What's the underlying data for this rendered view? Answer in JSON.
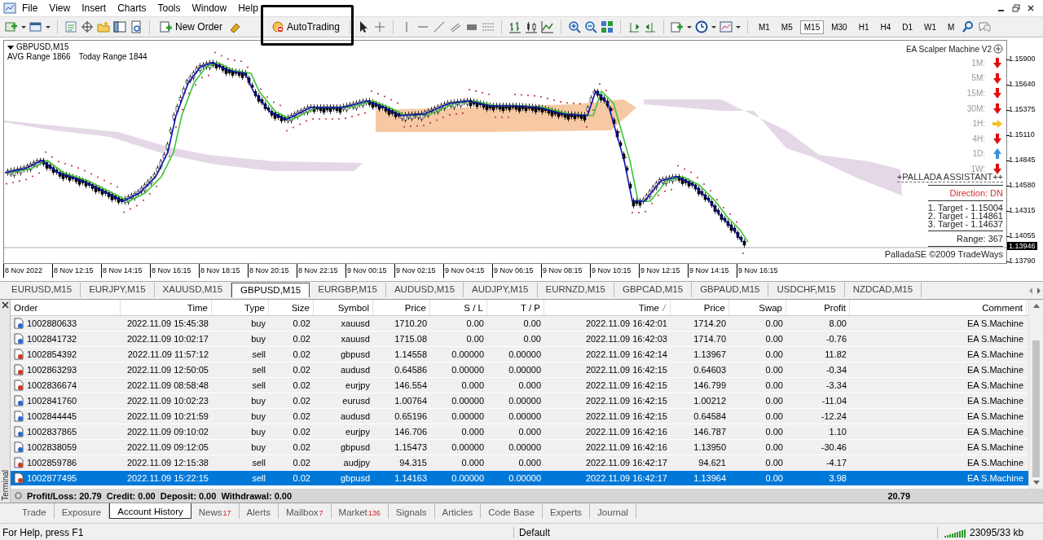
{
  "menu": [
    "File",
    "View",
    "Insert",
    "Charts",
    "Tools",
    "Window",
    "Help"
  ],
  "toolbar": {
    "new_order": "New Order",
    "autotrading": "AutoTrading",
    "timeframes": [
      {
        "label": "M1",
        "selected": false
      },
      {
        "label": "M5",
        "selected": false
      },
      {
        "label": "M15",
        "selected": true
      },
      {
        "label": "M30",
        "selected": false
      },
      {
        "label": "H1",
        "selected": false
      },
      {
        "label": "H4",
        "selected": false
      },
      {
        "label": "D1",
        "selected": false
      },
      {
        "label": "W1",
        "selected": false
      },
      {
        "label": "M",
        "selected": false
      }
    ]
  },
  "chart": {
    "title": "GBPUSD,M15",
    "avg_range": "AVG Range 1866",
    "today_range": "Today Range 1844",
    "price_ticks": [
      "1.15900",
      "1.15640",
      "1.15375",
      "1.15110",
      "1.14845",
      "1.14580",
      "1.14315",
      "1.14055",
      "1.13790"
    ],
    "current_price": "1.13946",
    "time_labels": [
      "8 Nov 2022",
      "8 Nov 12:15",
      "8 Nov 14:15",
      "8 Nov 16:15",
      "8 Nov 18:15",
      "8 Nov 20:15",
      "8 Nov 22:15",
      "9 Nov 00:15",
      "9 Nov 02:15",
      "9 Nov 04:15",
      "9 Nov 06:15",
      "9 Nov 08:15",
      "9 Nov 10:15",
      "9 Nov 12:15",
      "9 Nov 14:15",
      "9 Nov 16:15"
    ],
    "indicator": {
      "title": "EA Scalper Machine V2",
      "signals": [
        {
          "label": "1M:",
          "kind": "down"
        },
        {
          "label": "5M:",
          "kind": "down"
        },
        {
          "label": "15M:",
          "kind": "down"
        },
        {
          "label": "30M:",
          "kind": "down"
        },
        {
          "label": "1H:",
          "kind": "right"
        },
        {
          "label": "4H:",
          "kind": "down"
        },
        {
          "label": "1D:",
          "kind": "up"
        },
        {
          "label": "1W:",
          "kind": "down"
        }
      ],
      "assistant": "+PALLADA ASSISTANT++",
      "direction": "Direction: DN",
      "targets": [
        "1. Target - 1.15004",
        "2. Target - 1.14861",
        "3. Target - 1.14637"
      ],
      "range": "Range: 367",
      "credit": "PalladaSE ©2009 TradeWays"
    }
  },
  "symbol_tabs": [
    {
      "label": "EURUSD,M15",
      "selected": false
    },
    {
      "label": "EURJPY,M15",
      "selected": false
    },
    {
      "label": "XAUUSD,M15",
      "selected": false
    },
    {
      "label": "GBPUSD,M15",
      "selected": true
    },
    {
      "label": "EURGBP,M15",
      "selected": false
    },
    {
      "label": "AUDUSD,M15",
      "selected": false
    },
    {
      "label": "AUDJPY,M15",
      "selected": false
    },
    {
      "label": "EURNZD,M15",
      "selected": false
    },
    {
      "label": "GBPCAD,M15",
      "selected": false
    },
    {
      "label": "GBPAUD,M15",
      "selected": false
    },
    {
      "label": "USDCHF,M15",
      "selected": false
    },
    {
      "label": "NZDCAD,M15",
      "selected": false
    }
  ],
  "table": {
    "columns": [
      {
        "label": "Order",
        "sorted": false
      },
      {
        "label": "Time",
        "sorted": false
      },
      {
        "label": "Type",
        "sorted": false
      },
      {
        "label": "Size",
        "sorted": false
      },
      {
        "label": "Symbol",
        "sorted": false
      },
      {
        "label": "Price",
        "sorted": false
      },
      {
        "label": "S / L",
        "sorted": false
      },
      {
        "label": "T / P",
        "sorted": false
      },
      {
        "label": "Time",
        "sorted": true
      },
      {
        "label": "Price",
        "sorted": false
      },
      {
        "label": "Swap",
        "sorted": false
      },
      {
        "label": "Profit",
        "sorted": false
      },
      {
        "label": "Comment",
        "sorted": false
      }
    ],
    "rows": [
      {
        "kind": "buy",
        "selected": false,
        "cells": [
          "1002880633",
          "2022.11.09 15:45:38",
          "buy",
          "0.02",
          "xauusd",
          "1710.20",
          "0.00",
          "0.00",
          "2022.11.09 16:42:01",
          "1714.20",
          "0.00",
          "8.00",
          "EA S.Machine"
        ]
      },
      {
        "kind": "buy",
        "selected": false,
        "cells": [
          "1002841732",
          "2022.11.09 10:02:17",
          "buy",
          "0.02",
          "xauusd",
          "1715.08",
          "0.00",
          "0.00",
          "2022.11.09 16:42:03",
          "1714.70",
          "0.00",
          "-0.76",
          "EA S.Machine"
        ]
      },
      {
        "kind": "sell",
        "selected": false,
        "cells": [
          "1002854392",
          "2022.11.09 11:57:12",
          "sell",
          "0.02",
          "gbpusd",
          "1.14558",
          "0.00000",
          "0.00000",
          "2022.11.09 16:42:14",
          "1.13967",
          "0.00",
          "11.82",
          "EA S.Machine"
        ]
      },
      {
        "kind": "sell",
        "selected": false,
        "cells": [
          "1002863293",
          "2022.11.09 12:50:05",
          "sell",
          "0.02",
          "audusd",
          "0.64586",
          "0.00000",
          "0.00000",
          "2022.11.09 16:42:15",
          "0.64603",
          "0.00",
          "-0.34",
          "EA S.Machine"
        ]
      },
      {
        "kind": "sell",
        "selected": false,
        "cells": [
          "1002836674",
          "2022.11.09 08:58:48",
          "sell",
          "0.02",
          "eurjpy",
          "146.554",
          "0.000",
          "0.000",
          "2022.11.09 16:42:15",
          "146.799",
          "0.00",
          "-3.34",
          "EA S.Machine"
        ]
      },
      {
        "kind": "buy",
        "selected": false,
        "cells": [
          "1002841760",
          "2022.11.09 10:02:23",
          "buy",
          "0.02",
          "eurusd",
          "1.00764",
          "0.00000",
          "0.00000",
          "2022.11.09 16:42:15",
          "1.00212",
          "0.00",
          "-11.04",
          "EA S.Machine"
        ]
      },
      {
        "kind": "buy",
        "selected": false,
        "cells": [
          "1002844445",
          "2022.11.09 10:21:59",
          "buy",
          "0.02",
          "audusd",
          "0.65196",
          "0.00000",
          "0.00000",
          "2022.11.09 16:42:15",
          "0.64584",
          "0.00",
          "-12.24",
          "EA S.Machine"
        ]
      },
      {
        "kind": "buy",
        "selected": false,
        "cells": [
          "1002837865",
          "2022.11.09 09:10:02",
          "buy",
          "0.02",
          "eurjpy",
          "146.706",
          "0.000",
          "0.000",
          "2022.11.09 16:42:16",
          "146.787",
          "0.00",
          "1.10",
          "EA S.Machine"
        ]
      },
      {
        "kind": "buy",
        "selected": false,
        "cells": [
          "1002838059",
          "2022.11.09 09:12:05",
          "buy",
          "0.02",
          "gbpusd",
          "1.15473",
          "0.00000",
          "0.00000",
          "2022.11.09 16:42:16",
          "1.13950",
          "0.00",
          "-30.46",
          "EA S.Machine"
        ]
      },
      {
        "kind": "sell",
        "selected": false,
        "cells": [
          "1002859786",
          "2022.11.09 12:15:38",
          "sell",
          "0.02",
          "audjpy",
          "94.315",
          "0.000",
          "0.000",
          "2022.11.09 16:42:17",
          "94.621",
          "0.00",
          "-4.17",
          "EA S.Machine"
        ]
      },
      {
        "kind": "sell",
        "selected": true,
        "cells": [
          "1002877495",
          "2022.11.09 15:22:15",
          "sell",
          "0.02",
          "gbpusd",
          "1.14163",
          "0.00000",
          "0.00000",
          "2022.11.09 16:42:17",
          "1.13964",
          "0.00",
          "3.98",
          "EA S.Machine"
        ]
      }
    ],
    "summary": "Profit/Loss: 20.79  Credit: 0.00  Deposit: 0.00  Withdrawal: 0.00",
    "total_profit": "20.79"
  },
  "terminal_label": "Terminal",
  "bottom_tabs": [
    {
      "label": "Trade",
      "selected": false
    },
    {
      "label": "Exposure",
      "selected": false
    },
    {
      "label": "Account History",
      "selected": true
    },
    {
      "label": "News",
      "badge": "17",
      "selected": false
    },
    {
      "label": "Alerts",
      "selected": false
    },
    {
      "label": "Mailbox",
      "badge": "7",
      "selected": false
    },
    {
      "label": "Market",
      "badge": "136",
      "selected": false
    },
    {
      "label": "Signals",
      "selected": false
    },
    {
      "label": "Articles",
      "selected": false
    },
    {
      "label": "Code Base",
      "selected": false
    },
    {
      "label": "Experts",
      "selected": false
    },
    {
      "label": "Journal",
      "selected": false
    }
  ],
  "status_bar": {
    "help": "For Help, press F1",
    "profile": "Default",
    "traffic": "23095/33 kb"
  }
}
